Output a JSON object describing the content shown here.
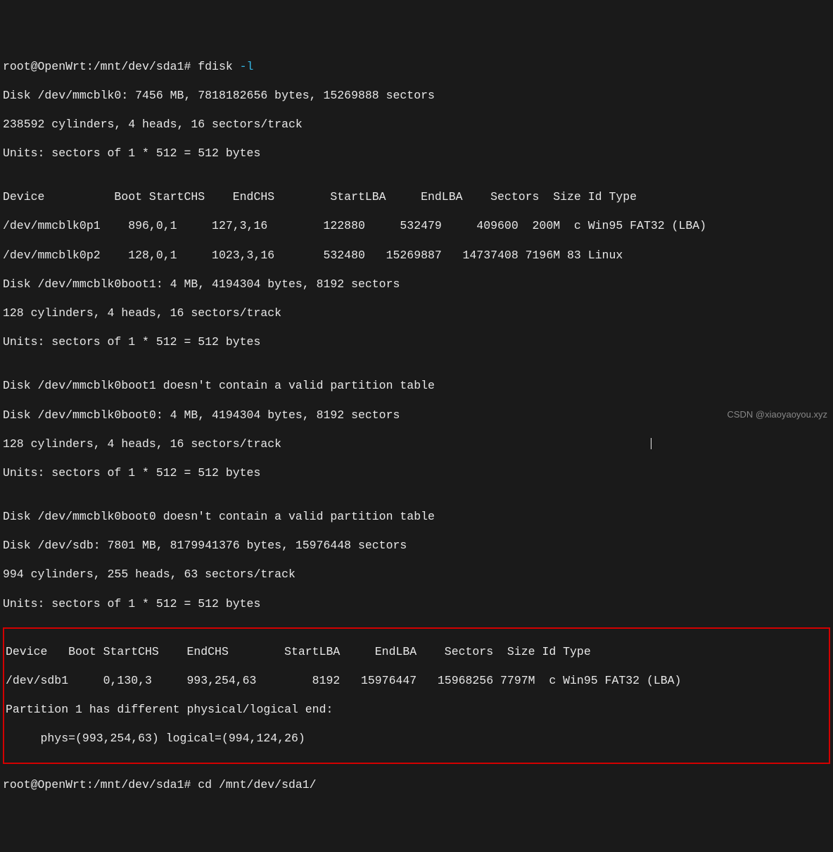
{
  "top_partial": "root@OpenWrt:/mnt/dev/sda1# fdisk ",
  "top_partial_flag": "-l",
  "disk_mmcblk0_line": "Disk /dev/mmcblk0: 7456 MB, 7818182656 bytes, 15269888 sectors",
  "mmcblk0_geom": "238592 cylinders, 4 heads, 16 sectors/track",
  "units": "Units: sectors of 1 * 512 = 512 bytes",
  "blank": "",
  "table1_header": "Device          Boot StartCHS    EndCHS        StartLBA     EndLBA    Sectors  Size Id Type",
  "table1_row1": "/dev/mmcblk0p1    896,0,1     127,3,16        122880     532479     409600  200M  c Win95 FAT32 (LBA)",
  "table1_row2": "/dev/mmcblk0p2    128,0,1     1023,3,16       532480   15269887   14737408 7196M 83 Linux",
  "boot1_disk": "Disk /dev/mmcblk0boot1: 4 MB, 4194304 bytes, 8192 sectors",
  "boot_geom": "128 cylinders, 4 heads, 16 sectors/track",
  "boot1_invalid": "Disk /dev/mmcblk0boot1 doesn't contain a valid partition table",
  "boot0_disk": "Disk /dev/mmcblk0boot0: 4 MB, 4194304 bytes, 8192 sectors",
  "cursor_pad": "                                                     ",
  "boot0_invalid": "Disk /dev/mmcblk0boot0 doesn't contain a valid partition table",
  "sdb_disk": "Disk /dev/sdb: 7801 MB, 8179941376 bytes, 15976448 sectors",
  "sdb_geom": "994 cylinders, 255 heads, 63 sectors/track",
  "box_header": "Device   Boot StartCHS    EndCHS        StartLBA     EndLBA    Sectors  Size Id Type",
  "box_row": "/dev/sdb1     0,130,3     993,254,63        8192   15976447   15968256 7797M  c Win95 FAT32 (LBA)",
  "box_warn1": "Partition 1 has different physical/logical end:",
  "box_warn2": "     phys=(993,254,63) logical=(994,124,26)",
  "prompt2": "root@OpenWrt:/mnt/dev/sda1# cd /mnt/dev/sda1/",
  "watermark": "CSDN @xiaoyaoyou.xyz"
}
